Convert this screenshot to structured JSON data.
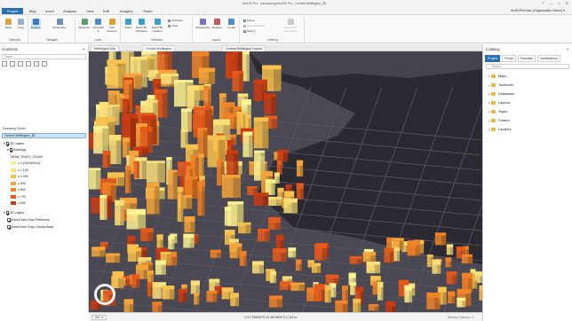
{
  "titlebar": {
    "title": "ArcGIS Pro - Introducing ArcGIS Pro - Central Wellington_3D",
    "controls": [
      "?",
      "—",
      "□",
      "✕"
    ]
  },
  "tabs": {
    "project": "Project",
    "items": [
      "Map",
      "Insert",
      "Analysis",
      "View",
      "Edit",
      "Imagery",
      "Share"
    ],
    "user": "AnGISProUser (Organization Name) ▾"
  },
  "ribbon": {
    "groups": [
      {
        "label": "Clipboard",
        "buttons": [
          "Paste",
          "Copy"
        ]
      },
      {
        "label": "Navigate",
        "buttons": [
          "Explore",
          "Bookmarks"
        ]
      },
      {
        "label": "Layer",
        "buttons": [
          "Basemap",
          "Add Data ▾",
          "Add Preset ▾"
        ]
      },
      {
        "label": "Selection",
        "buttons": [
          "Select",
          "Select By Attributes",
          "Select By Location"
        ]
      },
      {
        "label": "Inquiry",
        "buttons": [
          "Infographics",
          "Measure",
          "Locate"
        ]
      },
      {
        "label": "Labeling",
        "buttons": [
          "Convert To Annotation"
        ]
      }
    ],
    "small_items": [
      "Attributes",
      "Clear",
      "Pause",
      "View Unplaced",
      "More ▾"
    ]
  },
  "contents": {
    "title": "Contents",
    "search_placeholder": "Search",
    "drawing_order": "Drawing Order",
    "map_name": "Central Wellington_3D",
    "layer3d_group": "3D Layers",
    "buildings": "Buildings",
    "field": "MEAN_YEARLY_SOLAR",
    "legend": [
      {
        "label": "≤ 1,248 kWh/m2",
        "color": "#fdf291"
      },
      {
        "label": "≤ 1,100",
        "color": "#fbe07a"
      },
      {
        "label": "≤ 1,000",
        "color": "#f9c24e"
      },
      {
        "label": "≤ 900",
        "color": "#f6a43a"
      },
      {
        "label": "≤ 800",
        "color": "#f08228"
      },
      {
        "label": "≤ 700",
        "color": "#e55a1c"
      },
      {
        "label": "≤ 600",
        "color": "#c93b12"
      }
    ],
    "layer2d_group": "2D Layers",
    "basemap1": "World Dark Gray Reference",
    "basemap2": "World Dark Gray Canvas Base"
  },
  "views": [
    "Wellington City",
    "Central Wellington",
    "Central Wellington Layout"
  ],
  "status": {
    "scale": "601 m",
    "coords": "174.7789930°E 41.2870523°S   2,743 m",
    "selection": "Selected Features: 0"
  },
  "catalog": {
    "title": "Catalog",
    "tabs": [
      "Project",
      "Portal",
      "Favorites",
      "Notifications"
    ],
    "search_placeholder": "Search",
    "items": [
      "Maps",
      "Toolboxes",
      "Databases",
      "Layouts",
      "Styles",
      "Folders",
      "Locators"
    ]
  },
  "colors": {
    "accent": "#2a6fb0",
    "map_bg": "#34323c",
    "water": "#2b2a33"
  }
}
